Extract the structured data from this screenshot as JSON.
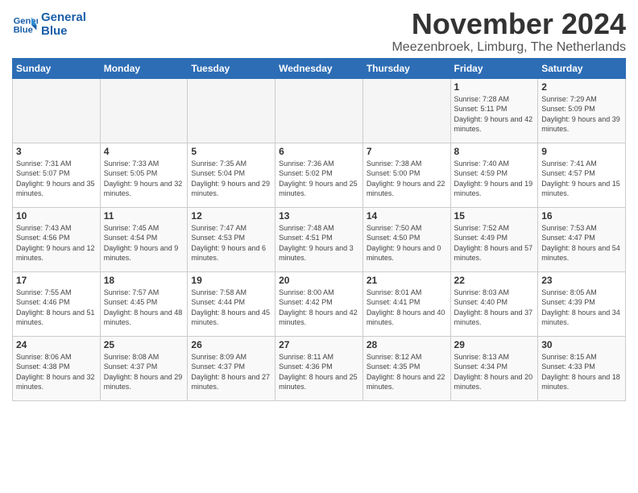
{
  "logo": {
    "line1": "General",
    "line2": "Blue"
  },
  "title": "November 2024",
  "location": "Meezenbroek, Limburg, The Netherlands",
  "headers": [
    "Sunday",
    "Monday",
    "Tuesday",
    "Wednesday",
    "Thursday",
    "Friday",
    "Saturday"
  ],
  "weeks": [
    [
      {
        "day": "",
        "info": ""
      },
      {
        "day": "",
        "info": ""
      },
      {
        "day": "",
        "info": ""
      },
      {
        "day": "",
        "info": ""
      },
      {
        "day": "",
        "info": ""
      },
      {
        "day": "1",
        "info": "Sunrise: 7:28 AM\nSunset: 5:11 PM\nDaylight: 9 hours and 42 minutes."
      },
      {
        "day": "2",
        "info": "Sunrise: 7:29 AM\nSunset: 5:09 PM\nDaylight: 9 hours and 39 minutes."
      }
    ],
    [
      {
        "day": "3",
        "info": "Sunrise: 7:31 AM\nSunset: 5:07 PM\nDaylight: 9 hours and 35 minutes."
      },
      {
        "day": "4",
        "info": "Sunrise: 7:33 AM\nSunset: 5:05 PM\nDaylight: 9 hours and 32 minutes."
      },
      {
        "day": "5",
        "info": "Sunrise: 7:35 AM\nSunset: 5:04 PM\nDaylight: 9 hours and 29 minutes."
      },
      {
        "day": "6",
        "info": "Sunrise: 7:36 AM\nSunset: 5:02 PM\nDaylight: 9 hours and 25 minutes."
      },
      {
        "day": "7",
        "info": "Sunrise: 7:38 AM\nSunset: 5:00 PM\nDaylight: 9 hours and 22 minutes."
      },
      {
        "day": "8",
        "info": "Sunrise: 7:40 AM\nSunset: 4:59 PM\nDaylight: 9 hours and 19 minutes."
      },
      {
        "day": "9",
        "info": "Sunrise: 7:41 AM\nSunset: 4:57 PM\nDaylight: 9 hours and 15 minutes."
      }
    ],
    [
      {
        "day": "10",
        "info": "Sunrise: 7:43 AM\nSunset: 4:56 PM\nDaylight: 9 hours and 12 minutes."
      },
      {
        "day": "11",
        "info": "Sunrise: 7:45 AM\nSunset: 4:54 PM\nDaylight: 9 hours and 9 minutes."
      },
      {
        "day": "12",
        "info": "Sunrise: 7:47 AM\nSunset: 4:53 PM\nDaylight: 9 hours and 6 minutes."
      },
      {
        "day": "13",
        "info": "Sunrise: 7:48 AM\nSunset: 4:51 PM\nDaylight: 9 hours and 3 minutes."
      },
      {
        "day": "14",
        "info": "Sunrise: 7:50 AM\nSunset: 4:50 PM\nDaylight: 9 hours and 0 minutes."
      },
      {
        "day": "15",
        "info": "Sunrise: 7:52 AM\nSunset: 4:49 PM\nDaylight: 8 hours and 57 minutes."
      },
      {
        "day": "16",
        "info": "Sunrise: 7:53 AM\nSunset: 4:47 PM\nDaylight: 8 hours and 54 minutes."
      }
    ],
    [
      {
        "day": "17",
        "info": "Sunrise: 7:55 AM\nSunset: 4:46 PM\nDaylight: 8 hours and 51 minutes."
      },
      {
        "day": "18",
        "info": "Sunrise: 7:57 AM\nSunset: 4:45 PM\nDaylight: 8 hours and 48 minutes."
      },
      {
        "day": "19",
        "info": "Sunrise: 7:58 AM\nSunset: 4:44 PM\nDaylight: 8 hours and 45 minutes."
      },
      {
        "day": "20",
        "info": "Sunrise: 8:00 AM\nSunset: 4:42 PM\nDaylight: 8 hours and 42 minutes."
      },
      {
        "day": "21",
        "info": "Sunrise: 8:01 AM\nSunset: 4:41 PM\nDaylight: 8 hours and 40 minutes."
      },
      {
        "day": "22",
        "info": "Sunrise: 8:03 AM\nSunset: 4:40 PM\nDaylight: 8 hours and 37 minutes."
      },
      {
        "day": "23",
        "info": "Sunrise: 8:05 AM\nSunset: 4:39 PM\nDaylight: 8 hours and 34 minutes."
      }
    ],
    [
      {
        "day": "24",
        "info": "Sunrise: 8:06 AM\nSunset: 4:38 PM\nDaylight: 8 hours and 32 minutes."
      },
      {
        "day": "25",
        "info": "Sunrise: 8:08 AM\nSunset: 4:37 PM\nDaylight: 8 hours and 29 minutes."
      },
      {
        "day": "26",
        "info": "Sunrise: 8:09 AM\nSunset: 4:37 PM\nDaylight: 8 hours and 27 minutes."
      },
      {
        "day": "27",
        "info": "Sunrise: 8:11 AM\nSunset: 4:36 PM\nDaylight: 8 hours and 25 minutes."
      },
      {
        "day": "28",
        "info": "Sunrise: 8:12 AM\nSunset: 4:35 PM\nDaylight: 8 hours and 22 minutes."
      },
      {
        "day": "29",
        "info": "Sunrise: 8:13 AM\nSunset: 4:34 PM\nDaylight: 8 hours and 20 minutes."
      },
      {
        "day": "30",
        "info": "Sunrise: 8:15 AM\nSunset: 4:33 PM\nDaylight: 8 hours and 18 minutes."
      }
    ]
  ]
}
